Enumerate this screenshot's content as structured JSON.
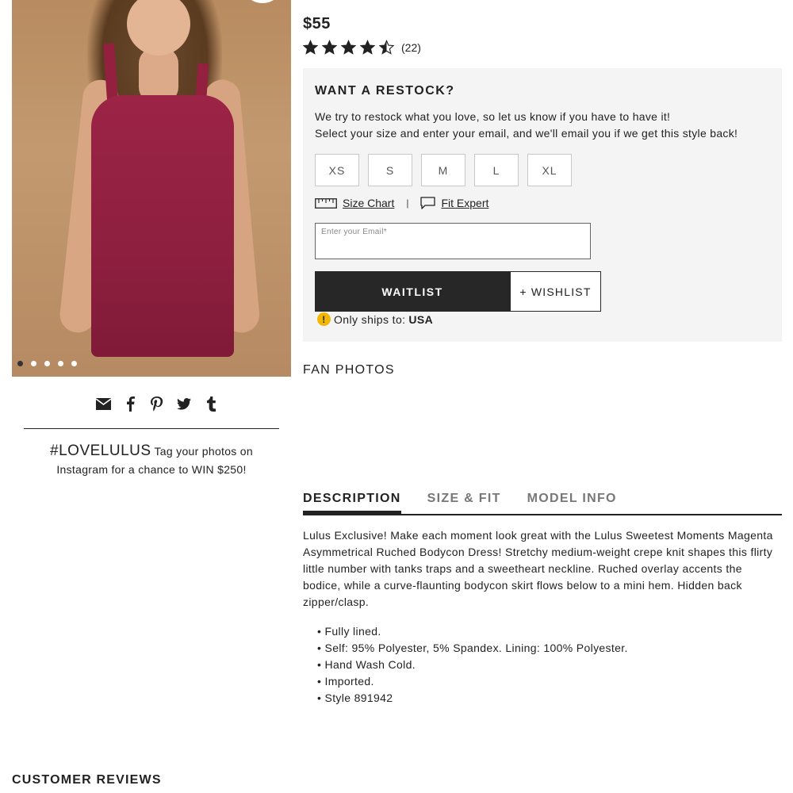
{
  "gallery": {
    "dot_count": 5,
    "active_dot": 0
  },
  "share": {
    "icons": [
      "email-icon",
      "facebook-icon",
      "pinterest-icon",
      "twitter-icon",
      "tumblr-icon"
    ]
  },
  "promo": {
    "hashtag": "#LOVELULUS",
    "text": " Tag your photos on Instagram for a chance to WIN $250!"
  },
  "product": {
    "price": "$55",
    "rating_value": 4.5,
    "rating_max": 5,
    "review_count": "(22)"
  },
  "restock": {
    "heading": "WANT A RESTOCK?",
    "line1": "We try to restock what you love, so let us know if you have to have it!",
    "line2": "Select your size and enter your email, and we'll email you if we get this style back!",
    "sizes": [
      "XS",
      "S",
      "M",
      "L",
      "XL"
    ],
    "size_chart_label": "Size Chart",
    "separator": "|",
    "fit_expert_label": "Fit Expert",
    "email_placeholder": "Enter your Email*",
    "email_value": "",
    "waitlist_label": "WAITLIST",
    "wishlist_label": "+ WISHLIST",
    "ships_label": "Only ships to:",
    "ships_country": "USA",
    "warning_glyph": "!"
  },
  "fan_photos": {
    "heading": "FAN PHOTOS"
  },
  "tabs": [
    {
      "label": "DESCRIPTION",
      "active": true
    },
    {
      "label": "SIZE & FIT",
      "active": false
    },
    {
      "label": "MODEL INFO",
      "active": false
    }
  ],
  "description": {
    "text": "Lulus Exclusive! Make each moment look great with the Lulus Sweetest Moments Magenta Asymmetrical Ruched Bodycon Dress! Stretchy medium-weight crepe knit shapes this flirty little number with tanks traps and a sweetheart neckline. Ruched overlay accents the bodice, while a curve-flaunting bodycon skirt flows below to a mini hem. Hidden back zipper/clasp.",
    "bullets": [
      "Fully lined.",
      "Self: 95% Polyester, 5% Spandex. Lining: 100% Polyester.",
      "Hand Wash Cold.",
      "Imported.",
      "Style 891942"
    ]
  },
  "reviews": {
    "heading": "CUSTOMER REVIEWS"
  },
  "colors": {
    "button_dark": "#272727",
    "panel_bg": "#f4f4f4",
    "warning": "#f2b705",
    "dress": "#8e1f3f"
  }
}
